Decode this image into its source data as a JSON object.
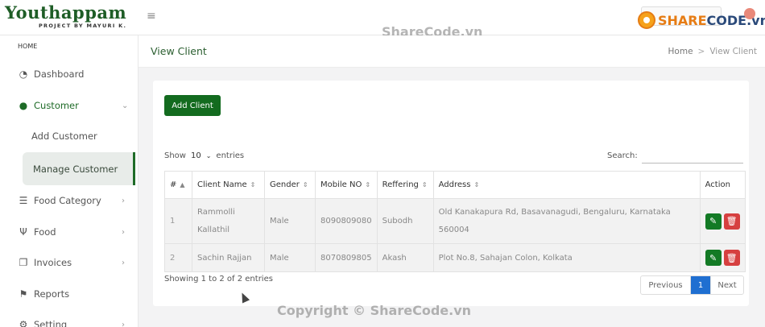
{
  "brand": {
    "name": "Youthappam",
    "sub": "PROJECT BY MAYURI K."
  },
  "watermarks": {
    "top": "ShareCode.vn",
    "bottom": "Copyright © ShareCode.vn",
    "logo_a": "SHARE",
    "logo_b": "CODE.vn"
  },
  "sidebar": {
    "home": "HOME",
    "items": [
      {
        "label": "Dashboard",
        "icon": "dashboard-icon"
      },
      {
        "label": "Customer",
        "icon": "user-icon"
      },
      {
        "label": "Food Category",
        "icon": "list-icon"
      },
      {
        "label": "Food",
        "icon": "utensils-icon"
      },
      {
        "label": "Invoices",
        "icon": "invoice-icon"
      },
      {
        "label": "Reports",
        "icon": "flag-icon"
      },
      {
        "label": "Setting",
        "icon": "gear-icon"
      }
    ],
    "sub": {
      "add": "Add Customer",
      "manage": "Manage Customer"
    }
  },
  "page": {
    "title": "View Client",
    "crumb_home": "Home",
    "crumb_current": "View Client"
  },
  "toolbar": {
    "add_label": "Add Client"
  },
  "table_controls": {
    "show": "Show",
    "entries": "entries",
    "page_size": "10",
    "search": "Search:",
    "info": "Showing 1 to 2 of 2 entries"
  },
  "table": {
    "headers": [
      "#",
      "Client Name",
      "Gender",
      "Mobile NO",
      "Reffering",
      "Address",
      "Action"
    ],
    "rows": [
      {
        "num": "1",
        "name": "Rammolli Kallathil",
        "gender": "Male",
        "mobile": "8090809080",
        "ref": "Subodh",
        "address": "Old Kanakapura Rd, Basavanagudi, Bengaluru, Karnataka 560004"
      },
      {
        "num": "2",
        "name": "Sachin Rajjan",
        "gender": "Male",
        "mobile": "8070809805",
        "ref": "Akash",
        "address": "Plot No.8, Sahajan Colon, Kolkata"
      }
    ]
  },
  "pager": {
    "prev": "Previous",
    "page": "1",
    "next": "Next"
  },
  "colors": {
    "brand_green": "#1e5d26",
    "button_green": "#136b1f",
    "danger": "#d64040",
    "active_page": "#1f6fd1"
  }
}
